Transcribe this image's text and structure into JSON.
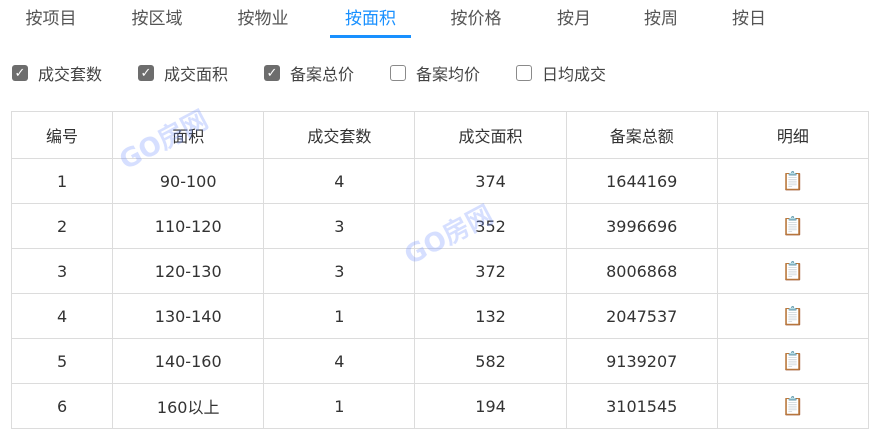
{
  "tabs": [
    {
      "label": "按项目"
    },
    {
      "label": "按区域"
    },
    {
      "label": "按物业"
    },
    {
      "label": "按面积",
      "active": true
    },
    {
      "label": "按价格"
    },
    {
      "label": "按月"
    },
    {
      "label": "按周"
    },
    {
      "label": "按日"
    }
  ],
  "filters": [
    {
      "label": "成交套数",
      "checked": true
    },
    {
      "label": "成交面积",
      "checked": true
    },
    {
      "label": "备案总价",
      "checked": true
    },
    {
      "label": "备案均价",
      "checked": false
    },
    {
      "label": "日均成交",
      "checked": false
    }
  ],
  "table": {
    "headers": [
      "编号",
      "面积",
      "成交套数",
      "成交面积",
      "备案总额",
      "明细"
    ],
    "rows": [
      [
        "1",
        "90-100",
        "4",
        "374",
        "1644169"
      ],
      [
        "2",
        "110-120",
        "3",
        "352",
        "3996696"
      ],
      [
        "3",
        "120-130",
        "3",
        "372",
        "8006868"
      ],
      [
        "4",
        "130-140",
        "1",
        "132",
        "2047537"
      ],
      [
        "5",
        "140-160",
        "4",
        "582",
        "9139207"
      ],
      [
        "6",
        "160以上",
        "1",
        "194",
        "3101545"
      ]
    ],
    "detail_icon": "📋"
  },
  "watermark": "GO房网",
  "colors": {
    "accent": "#1890ff",
    "checkbox_on": "#6d6d6d"
  }
}
